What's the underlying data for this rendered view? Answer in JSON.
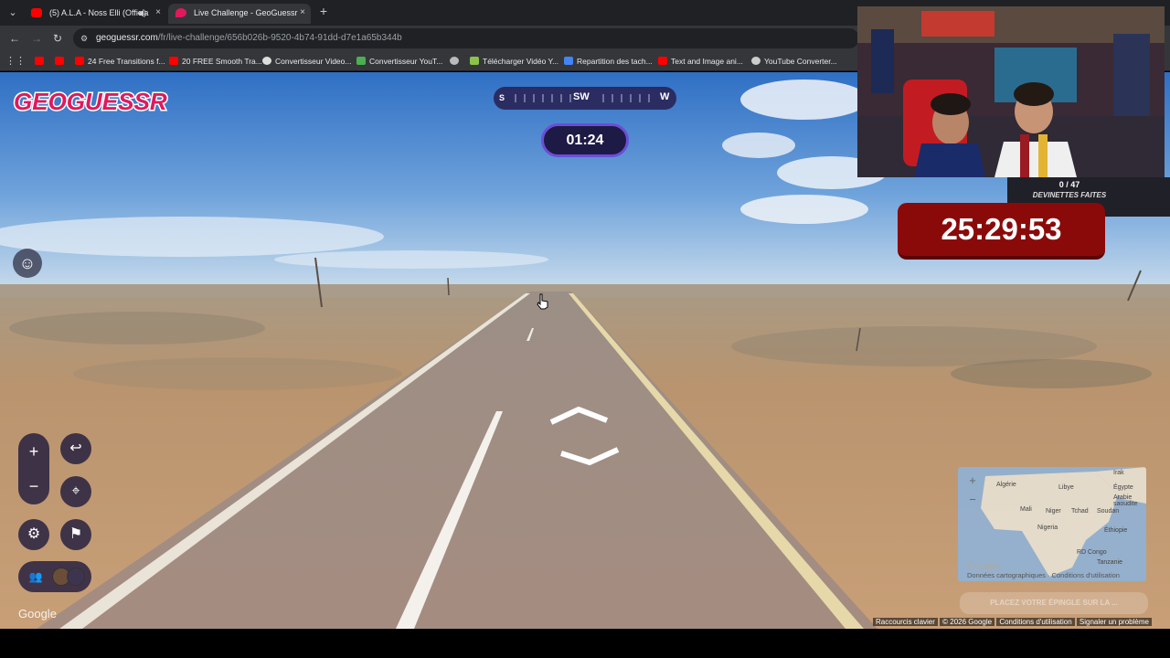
{
  "browser": {
    "tabs": [
      {
        "title": "(5) A.L.A - Noss Elli (Officia",
        "favicon_color": "#ff0000",
        "audio_icon": "speaker-icon",
        "active": false
      },
      {
        "title": "Live Challenge - GeoGuessr",
        "favicon_color": "#e0195b",
        "active": true
      }
    ],
    "close_glyph": "×",
    "new_tab_glyph": "+",
    "url_domain": "geoguessr.com",
    "url_path": "/fr/live-challenge/656b026b-9520-4b74-91dd-d7e1a65b344b",
    "bookmarks": [
      {
        "label": "",
        "icon_color": "#ff0000"
      },
      {
        "label": "",
        "icon_color": "#ff0000"
      },
      {
        "label": "24 Free Transitions f...",
        "icon_color": "#ff0000"
      },
      {
        "label": "20 FREE Smooth Tra...",
        "icon_color": "#ff0000"
      },
      {
        "label": "Convertisseur Video...",
        "icon_color": "#dddddd"
      },
      {
        "label": "Convertisseur YouT...",
        "icon_color": "#4caf50"
      },
      {
        "label": "",
        "icon_color": "#bbbbbb"
      },
      {
        "label": "Télécharger Vidéo Y...",
        "icon_color": "#8bc34a"
      },
      {
        "label": "Repartition des tach...",
        "icon_color": "#4285f4"
      },
      {
        "label": "Text and Image ani...",
        "icon_color": "#ff0000"
      },
      {
        "label": "YouTube Converter...",
        "icon_color": "#cccccc"
      }
    ]
  },
  "game": {
    "logo_text": "GEOGUESSR",
    "compass": {
      "left": "S",
      "center": "SW",
      "right": "W"
    },
    "round_timer": "01:24",
    "map_google": "Google",
    "map_credit": "Données cartographiques · Conditions d'utilisation",
    "place_hint": "PLACEZ VOTRE ÉPINGLE SUR LA ...",
    "map_labels": [
      "Irak",
      "Algérie",
      "Libye",
      "Égypte",
      "Arabie saoudite",
      "Mali",
      "Niger",
      "Tchad",
      "Soudan",
      "Nigeria",
      "Éthiopie",
      "RD Congo",
      "Tanzanie"
    ],
    "street_google": "Google",
    "footer_links": [
      "Raccourcis clavier",
      "© 2026 Google",
      "Conditions d'utilisation",
      "Signaler un problème"
    ]
  },
  "stream_overlay": {
    "guess_count": "0 / 47",
    "guess_label": "DEVINETTES FAITES",
    "big_timer": "25:29:53"
  },
  "colors": {
    "accent_purple": "#6c4dd6",
    "timer_bg": "#1d1a45",
    "logo_red": "#e0195b",
    "stream_timer_red": "#8a0a0a"
  }
}
